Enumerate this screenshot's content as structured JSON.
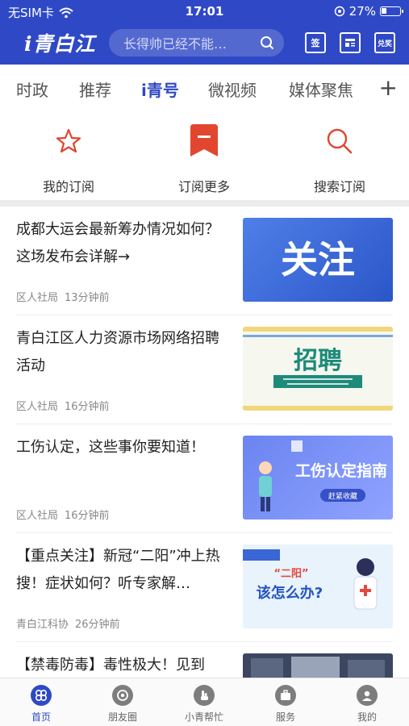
{
  "status_bar": {
    "carrier": "无SIM卡",
    "time": "17:01",
    "battery": "27%"
  },
  "header": {
    "logo": "i青白江",
    "search_placeholder": "长得帅已经不能…",
    "sign_label": "签",
    "redeem_label": "兑奖"
  },
  "tabs": [
    {
      "label": "时政"
    },
    {
      "label": "推荐"
    },
    {
      "label": "i青号",
      "active": true
    },
    {
      "label": "微视频"
    },
    {
      "label": "媒体聚焦"
    }
  ],
  "subscribe": [
    {
      "label": "我的订阅",
      "icon": "star-icon"
    },
    {
      "label": "订阅更多",
      "icon": "bookmark-icon"
    },
    {
      "label": "搜索订阅",
      "icon": "search-icon"
    }
  ],
  "news": [
    {
      "title": "成都大运会最新筹办情况如何？这场发布会详解→",
      "source": "区人社局",
      "time": "13分钟前",
      "thumb_text": "关注"
    },
    {
      "title": "青白江区人力资源市场网络招聘活动",
      "source": "区人社局",
      "time": "16分钟前",
      "thumb_text": "招聘"
    },
    {
      "title": "工伤认定，这些事你要知道！",
      "source": "区人社局",
      "time": "16分钟前",
      "thumb_text": "工伤认定指南",
      "thumb_sub": "赶紧收藏"
    },
    {
      "title": "【重点关注】新冠“二阳”冲上热搜！症状如何？听专家解…",
      "source": "青白江科协",
      "time": "26分钟前",
      "thumb_text": "该怎么办?",
      "thumb_sub": "“二阳”"
    },
    {
      "title": "【禁毒防毒】毒性极大！见到",
      "source": "",
      "time": ""
    }
  ],
  "bottom_nav": [
    {
      "label": "首页",
      "active": true
    },
    {
      "label": "朋友圈"
    },
    {
      "label": "小青帮忙"
    },
    {
      "label": "服务"
    },
    {
      "label": "我的"
    }
  ],
  "colors": {
    "brand": "#2f49c6",
    "accent_red": "#e2462f"
  }
}
